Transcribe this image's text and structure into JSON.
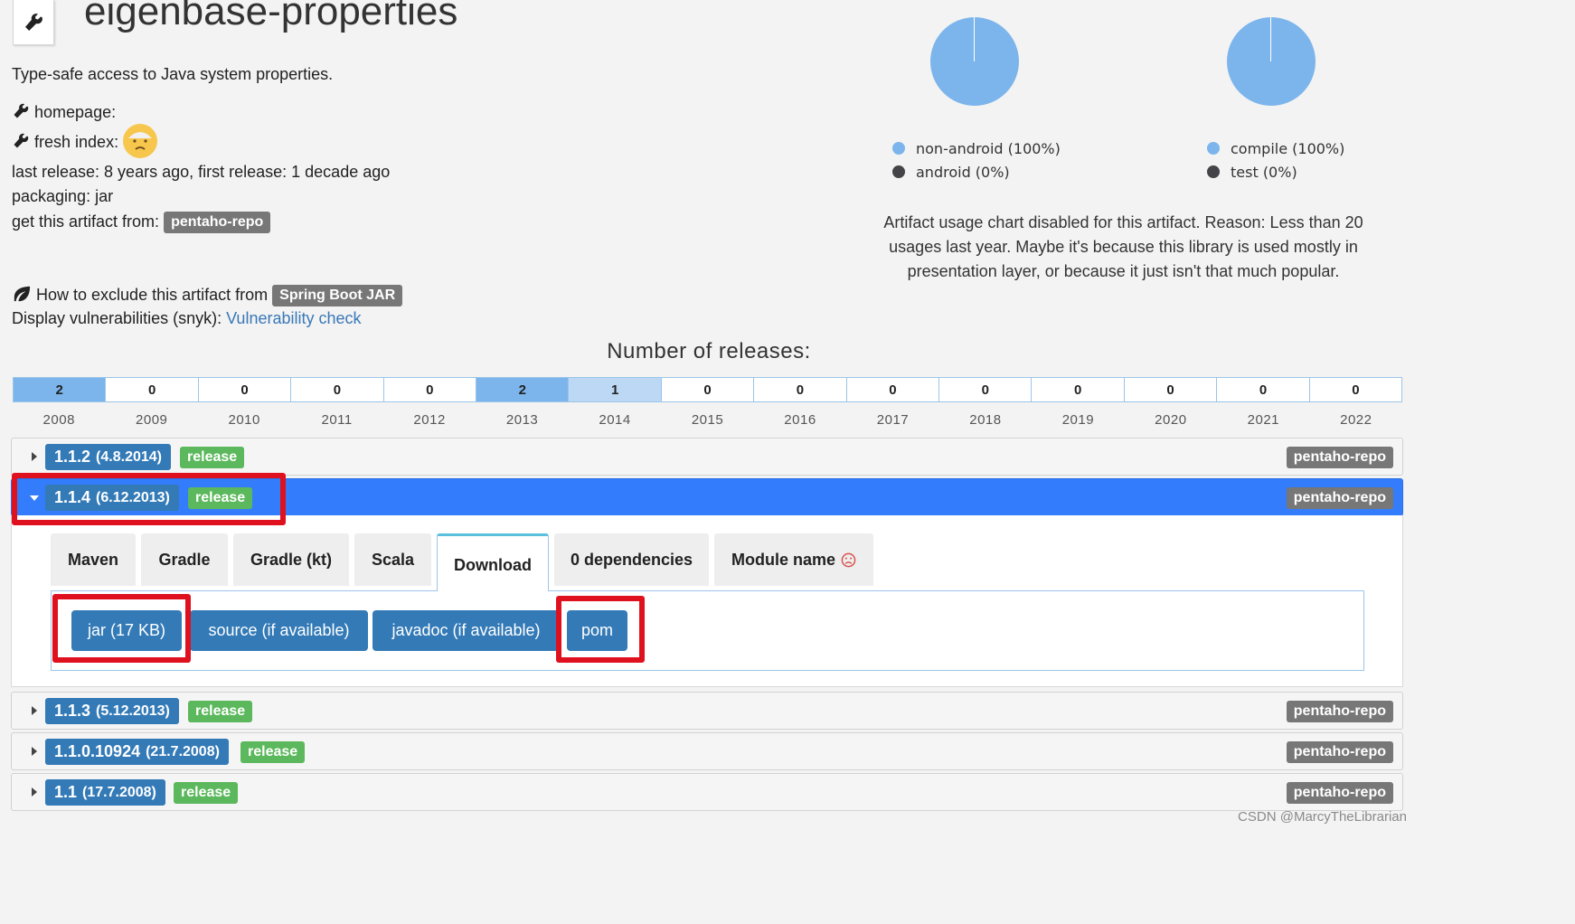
{
  "artifact": {
    "title": "eigenbase-properties",
    "description": "Type-safe access to Java system properties.",
    "homepage_label": "homepage:",
    "fresh_index_label": "fresh index:",
    "last_release": "last release: 8 years ago, first release: 1 decade ago",
    "packaging": "packaging: jar",
    "get_from_label": "get this artifact from:",
    "repo": "pentaho-repo",
    "exclude_label": "How to exclude this artifact from",
    "spring_boot": "Spring Boot JAR",
    "vuln_label": "Display vulnerabilities (snyk):",
    "vuln_link": "Vulnerability check"
  },
  "pies": {
    "left": {
      "legend": [
        "non-android (100%)",
        "android (0%)"
      ],
      "share": 100
    },
    "right": {
      "legend": [
        "compile (100%)",
        "test (0%)"
      ],
      "share": 100
    },
    "colors": {
      "primary": "#7cb5ec",
      "secondary": "#434348"
    }
  },
  "usage_note": "Artifact usage chart disabled for this artifact. Reason: Less than 20 usages last year. Maybe it's because this library is used mostly in presentation layer, or because it just isn't that much popular.",
  "chart_data": {
    "type": "heatmap",
    "title": "Number of releases:",
    "categories": [
      "2008",
      "2009",
      "2010",
      "2011",
      "2012",
      "2013",
      "2014",
      "2015",
      "2016",
      "2017",
      "2018",
      "2019",
      "2020",
      "2021",
      "2022"
    ],
    "values": [
      2,
      0,
      0,
      0,
      0,
      2,
      1,
      0,
      0,
      0,
      0,
      0,
      0,
      0,
      0
    ],
    "colors": {
      "high": "#7cb5ec",
      "low": "#bcd8f5",
      "zero": "#ffffff"
    }
  },
  "versions": [
    {
      "version": "1.1.2",
      "date": "(4.8.2014)",
      "badge": "release",
      "repo": "pentaho-repo",
      "expanded": false
    },
    {
      "version": "1.1.4",
      "date": "(6.12.2013)",
      "badge": "release",
      "repo": "pentaho-repo",
      "expanded": true
    },
    {
      "version": "1.1.3",
      "date": "(5.12.2013)",
      "badge": "release",
      "repo": "pentaho-repo",
      "expanded": false
    },
    {
      "version": "1.1.0.10924",
      "date": "(21.7.2008)",
      "badge": "release",
      "repo": "pentaho-repo",
      "expanded": false
    },
    {
      "version": "1.1",
      "date": "(17.7.2008)",
      "badge": "release",
      "repo": "pentaho-repo",
      "expanded": false
    }
  ],
  "tabs": [
    "Maven",
    "Gradle",
    "Gradle (kt)",
    "Scala",
    "Download",
    "0 dependencies",
    "Module name"
  ],
  "active_tab": "Download",
  "downloads": [
    "jar (17 KB)",
    "source (if available)",
    "javadoc (if available)",
    "pom"
  ],
  "watermark": "CSDN @MarcyTheLibrarian"
}
